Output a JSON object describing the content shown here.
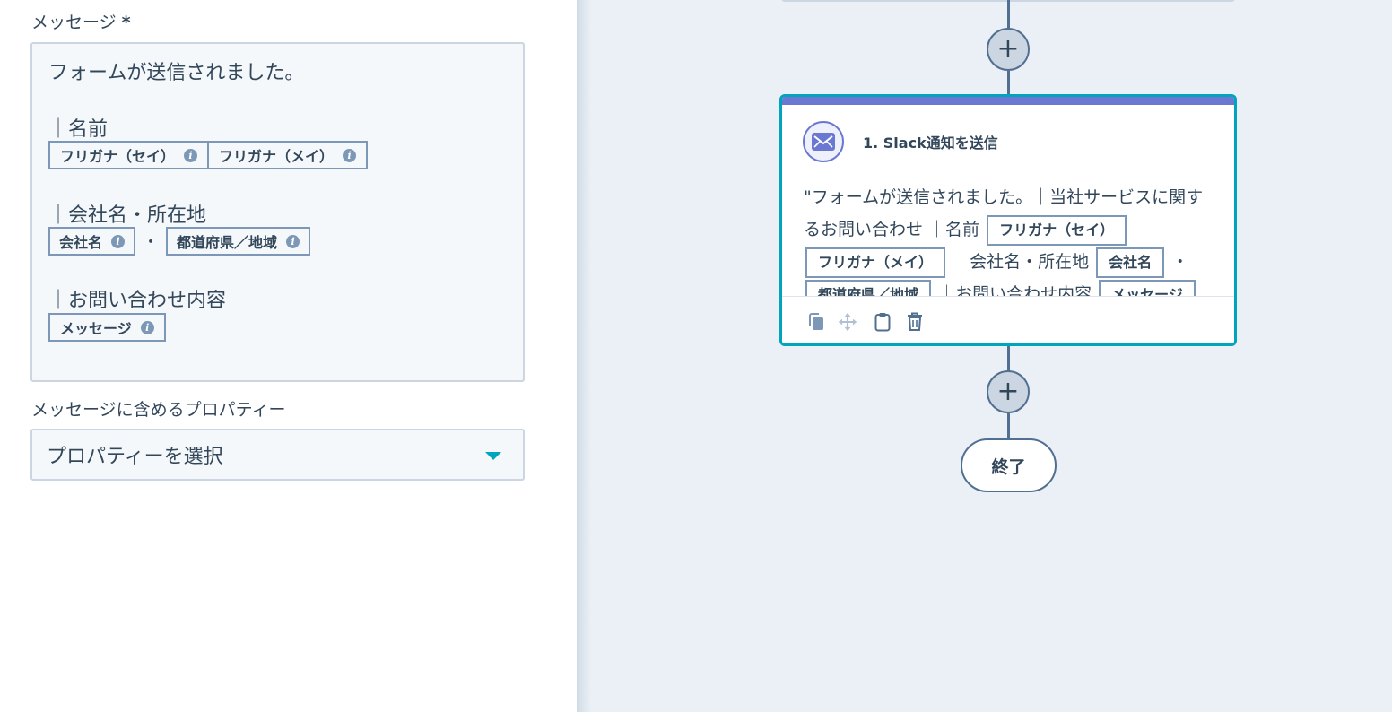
{
  "left_panel": {
    "message_label": "メッセージ",
    "required_mark": "*",
    "editor": {
      "line1": "フォームが送信されました。",
      "name_heading": "｜名前",
      "name_chips": [
        "フリガナ（セイ）",
        "フリガナ（メイ）"
      ],
      "company_heading": "｜会社名・所在地",
      "company_chips": [
        "会社名",
        "都道府県／地域"
      ],
      "company_sep": "・",
      "inquiry_heading": "｜お問い合わせ内容",
      "inquiry_chips": [
        "メッセージ"
      ]
    },
    "properties_label": "メッセージに含めるプロパティー",
    "properties_select": {
      "value": "プロパティーを選択"
    }
  },
  "canvas": {
    "card": {
      "title": "1. Slack通知を送信",
      "body_text_1": "\"フォームが送信されました。｜当社サービスに関するお問い合わせ ｜名前",
      "chip_1": "フリガナ（セイ）",
      "chip_2": "フリガナ（メイ）",
      "body_text_2": "｜会社名・所在地",
      "chip_3": "会社名",
      "body_text_3": "・",
      "chip_4": "都道府県／地域",
      "body_text_4": "｜お問い合わせ内容",
      "chip_5": "メッセージ"
    },
    "plus_symbol": "+",
    "end_label": "終了"
  },
  "colors": {
    "accent": "#00a4bd",
    "card_topbar": "#6a78d1",
    "chip_border": "#7c98b6",
    "text": "#33475b",
    "canvas_bg": "#eaf0f6"
  },
  "icons": {
    "info": "info-icon",
    "caret": "caret-down-icon",
    "slack_action": "envelope-icon",
    "tools": [
      "clone-icon",
      "move-icon",
      "clipboard-icon",
      "trash-icon"
    ]
  }
}
